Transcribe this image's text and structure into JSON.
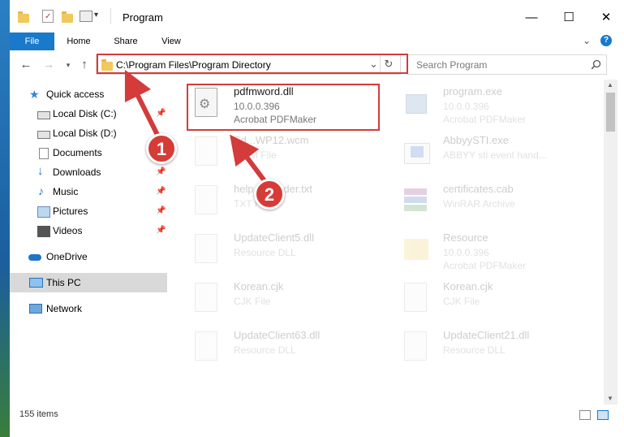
{
  "window": {
    "title": "Program",
    "controls": {
      "minimize": "—",
      "maximize": "☐",
      "close": "✕"
    }
  },
  "ribbon": {
    "tabs": [
      "File",
      "Home",
      "Share",
      "View"
    ],
    "help": "?",
    "collapse": "⌄"
  },
  "address": {
    "path": "C:\\Program Files\\Program Directory",
    "dropdown": "⌄",
    "refresh": "↻"
  },
  "search": {
    "placeholder": "Search Program"
  },
  "sidebar": {
    "items": [
      {
        "label": "Quick access",
        "icon": "star-icon",
        "pinned": false
      },
      {
        "label": "Local Disk (C:)",
        "icon": "drive-icon",
        "pinned": true
      },
      {
        "label": "Local Disk (D:)",
        "icon": "drive-icon",
        "pinned": false
      },
      {
        "label": "Documents",
        "icon": "documents-icon",
        "pinned": false
      },
      {
        "label": "Downloads",
        "icon": "download-icon",
        "pinned": true
      },
      {
        "label": "Music",
        "icon": "music-icon",
        "pinned": true
      },
      {
        "label": "Pictures",
        "icon": "pictures-icon",
        "pinned": true
      },
      {
        "label": "Videos",
        "icon": "videos-icon",
        "pinned": true
      },
      {
        "label": "OneDrive",
        "icon": "cloud-icon",
        "pinned": false
      },
      {
        "label": "This PC",
        "icon": "computer-icon",
        "pinned": false,
        "selected": true
      },
      {
        "label": "Network",
        "icon": "network-icon",
        "pinned": false
      }
    ]
  },
  "files": [
    {
      "name": "pdfmword.dll",
      "line1": "10.0.0.396",
      "line2": "Acrobat PDFMaker",
      "highlighted": true
    },
    {
      "name": "program.exe",
      "line1": "10.0.0.396",
      "line2": "Acrobat PDFMaker"
    },
    {
      "name": "Sd...WP12.wcm",
      "line1": "WCM File",
      "line2": ""
    },
    {
      "name": "AbbyySTI.exe",
      "line1": "ABBYY sti event hand...",
      "line2": ""
    },
    {
      "name": "help...ereader.txt",
      "line1": "TXT File",
      "line2": ""
    },
    {
      "name": "certificates.cab",
      "line1": "WinRAR Archive",
      "line2": ""
    },
    {
      "name": "UpdateClient5.dll",
      "line1": "Resource DLL",
      "line2": ""
    },
    {
      "name": "Resource",
      "line1": "10.0.0.396",
      "line2": "Acrobat PDFMaker"
    },
    {
      "name": "Korean.cjk",
      "line1": "CJK File",
      "line2": ""
    },
    {
      "name": "Korean.cjk",
      "line1": "CJK File",
      "line2": ""
    },
    {
      "name": "UpdateClient63.dll",
      "line1": "Resource DLL",
      "line2": ""
    },
    {
      "name": "UpdateClient21.dll",
      "line1": "Resource DLL",
      "line2": ""
    }
  ],
  "status": {
    "count": "155 items"
  },
  "annotations": {
    "step1": "1",
    "step2": "2"
  },
  "colors": {
    "accent": "#1979ca",
    "annotation": "#d43b3b"
  }
}
